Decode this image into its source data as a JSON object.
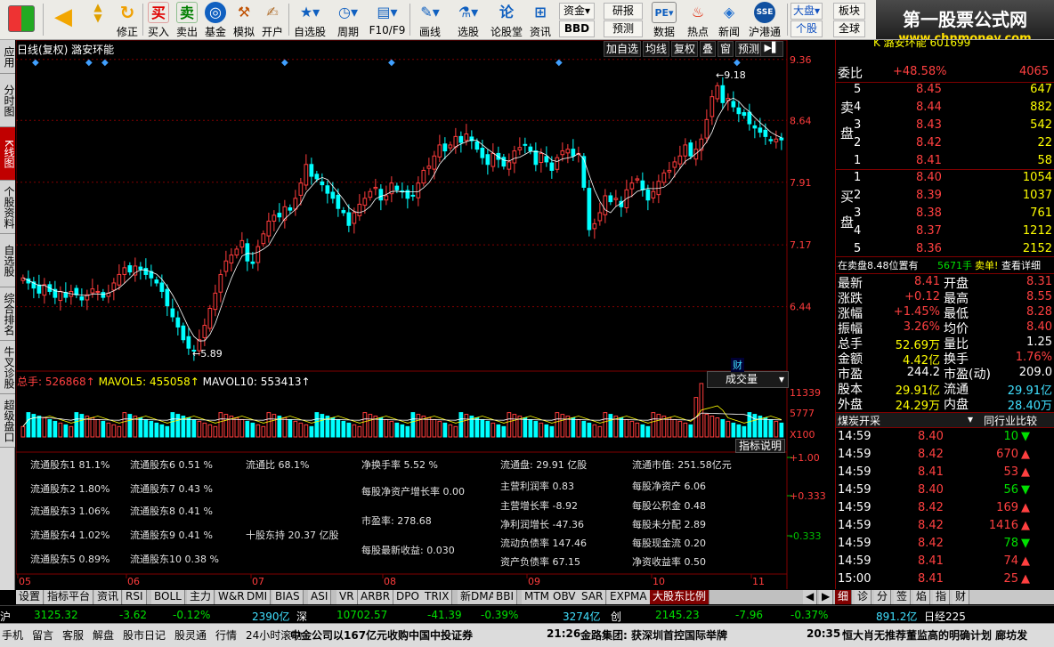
{
  "toolbar": {
    "items": [
      {
        "label": "",
        "icon": "back-arrow-icon"
      },
      {
        "label": "修正",
        "icon": "up-down-arrow-icon"
      },
      {
        "label": "买入",
        "icon": "buy-icon"
      },
      {
        "label": "卖出",
        "icon": "sell-icon"
      },
      {
        "label": "基金",
        "icon": "fund-icon"
      },
      {
        "label": "模拟",
        "icon": "simulate-icon"
      },
      {
        "label": "开户",
        "icon": "open-account-icon"
      },
      {
        "label": "自选股",
        "icon": "favorites-icon"
      },
      {
        "label": "周期",
        "icon": "clock-icon"
      },
      {
        "label": "F10/F9",
        "icon": "f10-icon"
      },
      {
        "label": "画线",
        "icon": "draw-line-icon"
      },
      {
        "label": "选股",
        "icon": "stock-pick-icon"
      },
      {
        "label": "论股堂",
        "icon": "forum-icon"
      },
      {
        "label": "资讯",
        "icon": "news-icon"
      },
      {
        "label": "数据",
        "icon": "data-icon"
      },
      {
        "label": "热点",
        "icon": "hot-icon"
      },
      {
        "label": "新闻",
        "icon": "news-paper-icon"
      },
      {
        "label": "沪港通",
        "icon": "sse-hke-icon"
      }
    ],
    "small": {
      "funds": "资金",
      "research": "研报",
      "bbd": "BBD",
      "forecast": "预测",
      "market": "大盘",
      "sector": "板块",
      "group": "个股",
      "all": "全球",
      "pe": "PE"
    },
    "brand_title": "第一股票公式网",
    "brand_url": "www.chnmoney.com"
  },
  "left_tabs": [
    "应用",
    "分时图",
    "K线图",
    "个股资料",
    "自选股",
    "综合排名",
    "牛叉诊股",
    "超级盘口"
  ],
  "chart": {
    "title": "日线(复权) 潞安环能",
    "buttons": [
      "加自选",
      "均线",
      "复权",
      "叠",
      "窗",
      "预测"
    ],
    "price_axis": [
      "9.36",
      "8.64",
      "7.91",
      "7.17",
      "6.44"
    ],
    "high_label": "9.18",
    "low_label": "5.89",
    "volume_legend": {
      "total": "总手: 526868↑",
      "mavol5": "MAVOL5: 455058↑",
      "mavol10": "MAVOL10: 553413↑"
    },
    "volume_select": "成交量",
    "volume_axis": [
      "11339",
      "5777",
      "X100"
    ],
    "fin_marker": "财",
    "indicator_help": "指标说明",
    "indicator_axis": [
      "+1.00",
      "+0.333",
      "-0.333"
    ],
    "date_axis": [
      "05",
      "06",
      "07",
      "08",
      "09",
      "10",
      "11"
    ],
    "fundamentals": [
      "流通股东1 81.1%",
      "流通股东6 0.51 %",
      "流通比 68.1%",
      "净换手率 5.52 %",
      "流通盘: 29.91 亿股",
      "流通市值: 251.58亿元",
      "流通股东2 1.80%",
      "流通股东7 0.43 %",
      "每股净资产增长率 0.00",
      "主营利润率 0.83",
      "每股净资产 6.06",
      "流通股东3 1.06%",
      "流通股东8 0.41 %",
      "主营增长率 -8.92",
      "每股公积金 0.48",
      "流通股东4 1.02%",
      "流通股东9 0.41 %",
      "十股东持 20.37 亿股",
      "市盈率: 278.68",
      "净利润增长 -47.36",
      "每股未分配 2.89",
      "流通股东5 0.89%",
      "流通股东10 0.38 %",
      "每股最新收益: 0.030",
      "流动负债率 147.46",
      "每股现金流 0.20",
      "资产负债率 67.15",
      "净资收益率 0.50"
    ]
  },
  "chart_data": {
    "type": "candlestick",
    "title": "日线(复权) 潞安环能",
    "ylim": [
      5.7,
      9.4
    ],
    "y_ticks": [
      9.36,
      8.64,
      7.91,
      7.17,
      6.44
    ],
    "x_ticks": [
      "05",
      "06",
      "07",
      "08",
      "09",
      "10",
      "11"
    ],
    "series_close": [
      6.78,
      6.72,
      6.66,
      6.6,
      6.7,
      6.62,
      6.55,
      6.62,
      6.55,
      6.62,
      6.58,
      6.52,
      6.58,
      6.65,
      6.62,
      6.55,
      6.6,
      6.72,
      6.82,
      6.9,
      6.85,
      6.92,
      6.88,
      6.82,
      6.78,
      6.72,
      6.62,
      6.45,
      6.32,
      6.2,
      6.05,
      5.95,
      5.92,
      6.05,
      6.22,
      6.42,
      6.6,
      6.82,
      6.98,
      7.05,
      7.12,
      7.22,
      6.98,
      6.95,
      7.15,
      7.3,
      7.45,
      7.52,
      7.5,
      7.62,
      7.58,
      7.72,
      7.9,
      8.12,
      7.98,
      7.95,
      7.88,
      7.78,
      7.72,
      7.6,
      7.55,
      7.4,
      7.55,
      7.65,
      7.72,
      7.8,
      7.85,
      7.7,
      7.75,
      7.9,
      7.82,
      7.8,
      7.72,
      7.75,
      7.9,
      8.05,
      8.1,
      8.22,
      8.35,
      8.28,
      8.35,
      8.45,
      8.38,
      8.48,
      8.4,
      8.3,
      8.2,
      8.12,
      8.25,
      8.18,
      8.1,
      8.15,
      8.28,
      8.32,
      8.35,
      8.28,
      8.12,
      8.25,
      8.15,
      8.05,
      8.2,
      8.28,
      8.3,
      8.22,
      8.25,
      7.85,
      7.35,
      7.42,
      7.55,
      7.75,
      7.68,
      7.72,
      7.62,
      7.82,
      7.9,
      7.95,
      7.82,
      7.7,
      7.8,
      7.92,
      8.02,
      8.05,
      8.15,
      8.22,
      8.35,
      8.22,
      8.3,
      8.42,
      8.65,
      8.92,
      9.05,
      8.85,
      8.9,
      8.8,
      8.72,
      8.7,
      8.6,
      8.55,
      8.5,
      8.45,
      8.4,
      8.42,
      8.41
    ],
    "volume_ylim": [
      0,
      11339
    ],
    "volume_ticks": [
      11339,
      5777
    ]
  },
  "quote": {
    "header": "K 潞安环能 601699",
    "webi_label": "委比",
    "webi_value": "+48.58%",
    "webi_diff": "4065",
    "sell_label": "卖盘",
    "buy_label": "买盘",
    "sell": [
      [
        "5",
        "8.45",
        "647"
      ],
      [
        "4",
        "8.44",
        "882"
      ],
      [
        "3",
        "8.43",
        "542"
      ],
      [
        "2",
        "8.42",
        "22"
      ],
      [
        "1",
        "8.41",
        "58"
      ]
    ],
    "buy": [
      [
        "1",
        "8.40",
        "1054"
      ],
      [
        "2",
        "8.39",
        "1037"
      ],
      [
        "3",
        "8.38",
        "761"
      ],
      [
        "4",
        "8.37",
        "1212"
      ],
      [
        "5",
        "8.36",
        "2152"
      ]
    ],
    "notice_left": "在卖盘8.48位置有",
    "notice_mid": "5671手",
    "notice_right": "卖单!",
    "notice_link": "查看详细",
    "stats": [
      [
        "最新",
        "8.41",
        "开盘",
        "8.31"
      ],
      [
        "涨跌",
        "+0.12",
        "最高",
        "8.55"
      ],
      [
        "涨幅",
        "+1.45%",
        "最低",
        "8.28"
      ],
      [
        "振幅",
        "3.26%",
        "均价",
        "8.40"
      ],
      [
        "总手",
        "52.69万",
        "量比",
        "1.25"
      ],
      [
        "金额",
        "4.42亿",
        "换手",
        "1.76%"
      ],
      [
        "市盈",
        "244.2",
        "市盈(动)",
        "209.0"
      ],
      [
        "股本",
        "29.91亿",
        "流通",
        "29.91亿"
      ],
      [
        "外盘",
        "24.29万",
        "内盘",
        "28.40万"
      ]
    ],
    "industry": "煤炭开采",
    "industry_compare": "同行业比较",
    "ticks": [
      [
        "14:59",
        "8.40",
        "10",
        "down"
      ],
      [
        "14:59",
        "8.42",
        "670",
        "up"
      ],
      [
        "14:59",
        "8.41",
        "53",
        "up"
      ],
      [
        "14:59",
        "8.40",
        "56",
        "down"
      ],
      [
        "14:59",
        "8.42",
        "169",
        "up"
      ],
      [
        "14:59",
        "8.42",
        "1416",
        "up"
      ],
      [
        "14:59",
        "8.42",
        "78",
        "down"
      ],
      [
        "14:59",
        "8.41",
        "74",
        "up"
      ],
      [
        "15:00",
        "8.41",
        "25",
        "up"
      ]
    ]
  },
  "indicator_tabs": [
    "设置",
    "指标平台",
    "资讯",
    "RSI",
    "BOLL",
    "主力",
    "W&R",
    "DMI",
    "BIAS",
    "ASI",
    "VR",
    "ARBR",
    "DPO",
    "TRIX",
    "新DMA",
    "BBI",
    "MTM",
    "OBV",
    "SAR",
    "EXPMA",
    "大股东比例"
  ],
  "right_tabs": [
    "细",
    "诊",
    "分",
    "签",
    "焰",
    "指",
    "财"
  ],
  "index_bar": {
    "sh_label": "沪",
    "sh_val": "3125.32",
    "sh_chg": "-3.62",
    "sh_pct": "-0.12%",
    "sh_amt": "2390亿",
    "sz_label": "深",
    "sz_val": "10702.57",
    "sz_chg": "-41.39",
    "sz_pct": "-0.39%",
    "sz_amt": "3274亿",
    "cy_label": "创",
    "cy_val": "2145.23",
    "cy_chg": "-7.96",
    "cy_pct": "-0.37%",
    "cy_amt": "891.2亿",
    "daily": "日经225"
  },
  "status_bar": {
    "items": [
      "手机",
      "留言",
      "客服",
      "解盘",
      "股市日记",
      "股灵通",
      "行情",
      "24小时滚动"
    ],
    "news1": "中金公司以167亿元收购中国中投证券",
    "news2_time": "21:26",
    "news2": "金路集团: 获深圳首控国际举牌",
    "news3_time": "20:35",
    "news3": "恒大肖无推荐董监高的明确计划 廊坊发"
  },
  "colors": {
    "up": "#ff3c3c",
    "down": "#00ffff",
    "grid": "#800000",
    "ma": "#ffffff",
    "ma2": "#ffff00"
  }
}
